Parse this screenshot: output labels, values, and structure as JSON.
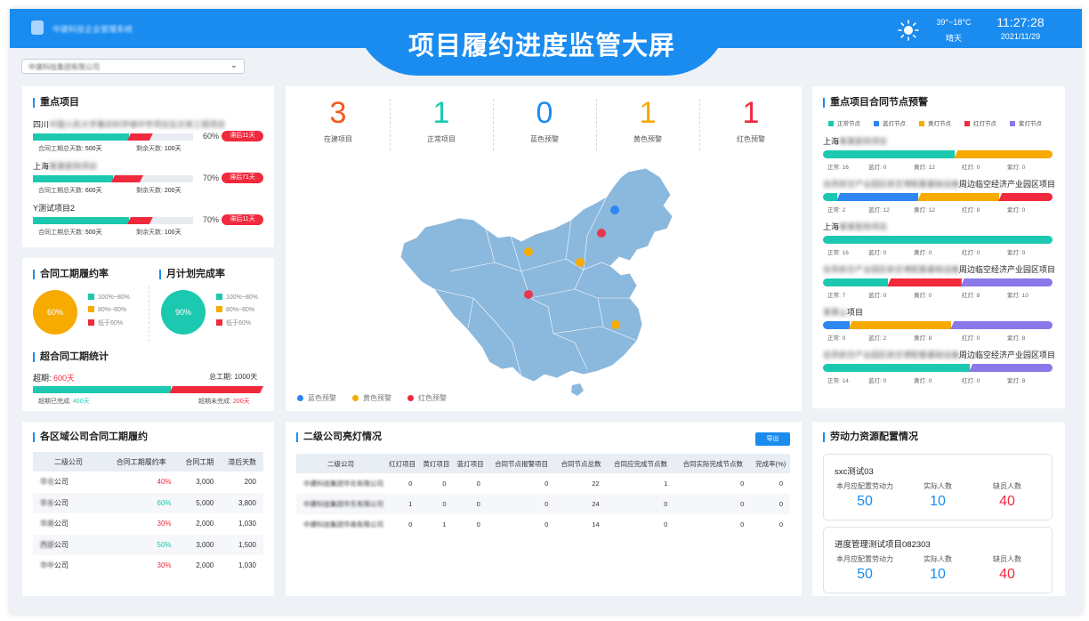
{
  "header": {
    "title": "项目履约进度监管大屏",
    "company": "中建科技企业管理系统",
    "temperature": "39°~18°C",
    "weather": "晴天",
    "time": "11:27:28",
    "date": "2021/11/29"
  },
  "company_select": {
    "value": "中建科技集团有限公司"
  },
  "key_projects": {
    "title": "重点项目",
    "total_days_label": "合同工期总天数:",
    "remaining_label": "剩余天数:",
    "items": [
      {
        "prefix": "四川",
        "name_blurred": "中国人民大学重庆科学城中学项目及文体工程项目",
        "progress": 60,
        "red_fraction": 0.16,
        "percent": "60%",
        "lag": "滞后11天",
        "total_days": "500天",
        "remaining": "100天"
      },
      {
        "prefix": "上海",
        "name_blurred": "某某医院项目",
        "progress": 50,
        "red_fraction": 0.2,
        "percent": "70%",
        "lag": "滞后71天",
        "total_days": "600天",
        "remaining": "200天"
      },
      {
        "prefix": "Y测试项目2",
        "name_blurred": "",
        "progress": 60,
        "red_fraction": 0.16,
        "percent": "70%",
        "lag": "滞后11天",
        "total_days": "500天",
        "remaining": "100天"
      }
    ]
  },
  "perf_rate": {
    "title": "合同工期履约率",
    "value": "60%",
    "color": "#f7aa00",
    "legend": [
      {
        "label": "100%~80%",
        "color": "#1cc9b0"
      },
      {
        "label": "80%~60%",
        "color": "#f7aa00"
      },
      {
        "label": "低于60%",
        "color": "#f0293d"
      }
    ]
  },
  "monthly_rate": {
    "title": "月计划完成率",
    "value": "90%",
    "color": "#1cc9b0",
    "legend": [
      {
        "label": "100%~80%",
        "color": "#1cc9b0"
      },
      {
        "label": "80%~60%",
        "color": "#f7aa00"
      },
      {
        "label": "低于60%",
        "color": "#f0293d"
      }
    ]
  },
  "overdue": {
    "title": "超合同工期统计",
    "overdue_label": "超期:",
    "overdue_value": "600天",
    "total_label": "总工期:",
    "total_value": "1000天",
    "done_label": "超期已完成:",
    "done_value": "400天",
    "undone_label": "超期未完成:",
    "undone_value": "200天",
    "done_fraction": 0.6
  },
  "stats": [
    {
      "value": "3",
      "label": "在建项目",
      "color": "#f45a18"
    },
    {
      "value": "1",
      "label": "正常项目",
      "color": "#1cc9b0"
    },
    {
      "value": "0",
      "label": "蓝色预警",
      "color": "#1a8cf0"
    },
    {
      "value": "1",
      "label": "黄色预警",
      "color": "#f7aa00"
    },
    {
      "value": "1",
      "label": "红色预警",
      "color": "#f0293d"
    }
  ],
  "map_legend": [
    {
      "label": "蓝色预警",
      "color": "#2e86f0"
    },
    {
      "label": "黄色预警",
      "color": "#f7aa00"
    },
    {
      "label": "红色预警",
      "color": "#f0293d"
    }
  ],
  "regional": {
    "title": "各区域公司合同工期履约",
    "columns": [
      "二级公司",
      "合同工期履约率",
      "合同工期",
      "滞后天数"
    ],
    "rows": [
      {
        "prefix": "华北",
        "suffix": "公司",
        "rate": "40%",
        "rate_color": "#f0293d",
        "duration": "3,000",
        "delay": "200"
      },
      {
        "prefix": "华东",
        "suffix": "公司",
        "rate": "60%",
        "rate_color": "#1cc9b0",
        "duration": "5,000",
        "delay": "3,800"
      },
      {
        "prefix": "华南",
        "suffix": "公司",
        "rate": "30%",
        "rate_color": "#f0293d",
        "duration": "2,000",
        "delay": "1,030"
      },
      {
        "prefix": "西部",
        "suffix": "公司",
        "rate": "50%",
        "rate_color": "#1cc9b0",
        "duration": "3,000",
        "delay": "1,500"
      },
      {
        "prefix": "华中",
        "suffix": "公司",
        "rate": "30%",
        "rate_color": "#f0293d",
        "duration": "2,000",
        "delay": "1,030"
      }
    ]
  },
  "lights": {
    "title": "二级公司亮灯情况",
    "export_label": "导出",
    "columns": [
      "二级公司",
      "红灯项目",
      "黄灯项目",
      "蓝灯项目",
      "合同节点报警项目",
      "合同节点总数",
      "合同应完成节点数",
      "合同实际完成节点数",
      "完成率(%)"
    ],
    "rows": [
      {
        "name": "中建科技集团华北有限公司",
        "cells": [
          "0",
          "0",
          "0",
          "0",
          "22",
          "1",
          "0",
          "0"
        ]
      },
      {
        "name": "中建科技集团华东有限公司",
        "cells": [
          "1",
          "0",
          "0",
          "0",
          "24",
          "0",
          "0",
          "0"
        ]
      },
      {
        "name": "中建科技集团华南有限公司",
        "cells": [
          "0",
          "1",
          "0",
          "0",
          "14",
          "0",
          "0",
          "0"
        ]
      }
    ]
  },
  "node_warnings": {
    "title": "重点项目合同节点预警",
    "legend": [
      {
        "label": "正常节点",
        "color": "#1cc9b0"
      },
      {
        "label": "蓝灯节点",
        "color": "#2e86f0"
      },
      {
        "label": "黄灯节点",
        "color": "#f7aa00"
      },
      {
        "label": "红灯节点",
        "color": "#f0293d"
      },
      {
        "label": "紫灯节点",
        "color": "#8a78e8"
      }
    ],
    "count_labels": [
      "正常:",
      "蓝灯:",
      "黄灯:",
      "红灯:",
      "紫灯:"
    ],
    "items": [
      {
        "prefix": "上海",
        "blurred": "某某医院项目",
        "suffix": "",
        "counts": [
          16,
          0,
          12,
          0,
          0
        ]
      },
      {
        "prefix": "",
        "blurred": "自贡航空产业园区航空港配套基础设施",
        "suffix": "周边临空经济产业园区项目",
        "counts": [
          2,
          12,
          12,
          8,
          0
        ]
      },
      {
        "prefix": "上海",
        "blurred": "某某医院项目",
        "suffix": "",
        "counts": [
          16,
          0,
          0,
          0,
          0
        ]
      },
      {
        "prefix": "",
        "blurred": "自贡航空产业园区航空港配套基础设施",
        "suffix": "周边临空经济产业园区项目",
        "counts": [
          7,
          0,
          0,
          8,
          10
        ]
      },
      {
        "prefix": "",
        "blurred": "某某山",
        "suffix": "项目",
        "counts": [
          0,
          2,
          8,
          0,
          8
        ]
      },
      {
        "prefix": "",
        "blurred": "自贡航空产业园区航空港配套基础设施",
        "suffix": "周边临空经济产业园区项目",
        "counts": [
          14,
          0,
          0,
          0,
          8
        ]
      }
    ]
  },
  "labor": {
    "title": "劳动力资源配置情况",
    "labels": [
      "本月应配置劳动力",
      "实际人数",
      "缺员人数"
    ],
    "cards": [
      {
        "name": "sxc测试03",
        "planned": "50",
        "actual": "10",
        "shortage": "40"
      },
      {
        "name": "进度管理测试项目082303",
        "planned": "50",
        "actual": "10",
        "shortage": "40"
      }
    ]
  }
}
